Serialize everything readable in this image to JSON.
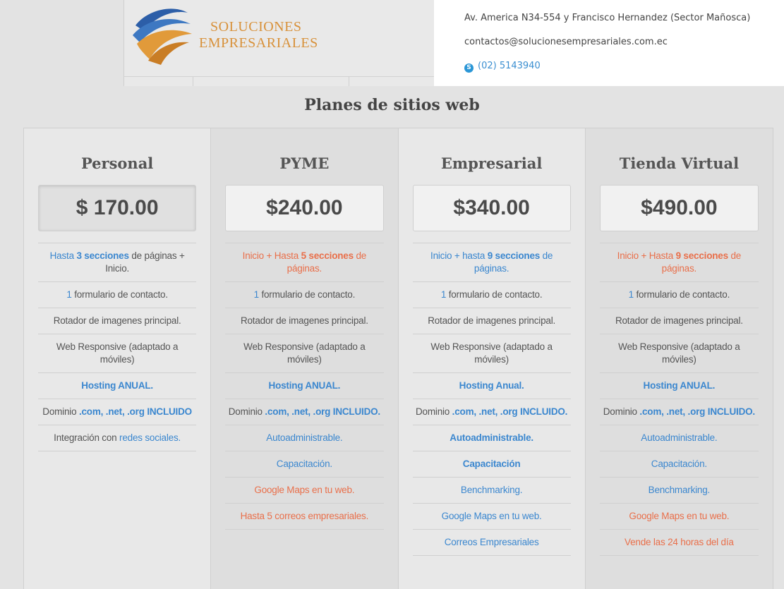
{
  "header": {
    "logo_line1": "SOLUCIONES",
    "logo_line2": "EMPRESARIALES",
    "address": "Av. America N34-554 y Francisco Hernandez (Sector Mañosca)",
    "email": "contactos@solucionesempresariales.com.ec",
    "phone": "(02) 5143940",
    "phone_icon": "skype-icon"
  },
  "section_title": "Planes de sitios web",
  "colors": {
    "blue": "#3b87cf",
    "orange": "#e96f4a"
  },
  "plans": [
    {
      "name": "Personal",
      "price": "$ 170.00",
      "features": [
        [
          {
            "t": "Hasta ",
            "c": "blue"
          },
          {
            "t": "3 secciones",
            "c": "blue",
            "b": true
          },
          {
            "t": " de páginas + Inicio.",
            "c": ""
          }
        ],
        [
          {
            "t": "1",
            "c": "blue"
          },
          {
            "t": " formulario de contacto.",
            "c": ""
          }
        ],
        [
          {
            "t": "Rotador de imagenes principal.",
            "c": ""
          }
        ],
        [
          {
            "t": "Web Responsive (adaptado a móviles)",
            "c": ""
          }
        ],
        [
          {
            "t": "Hosting ANUAL.",
            "c": "blue",
            "b": true
          }
        ],
        [
          {
            "t": "Dominio ",
            "c": ""
          },
          {
            "t": ".com, .net, .org INCLUIDO",
            "c": "blue",
            "b": true
          }
        ],
        [
          {
            "t": "Integración con ",
            "c": ""
          },
          {
            "t": "redes sociales.",
            "c": "blue"
          }
        ]
      ]
    },
    {
      "name": "PYME",
      "price": "$240.00",
      "features": [
        [
          {
            "t": "Inicio + Hasta ",
            "c": "orange"
          },
          {
            "t": "5 secciones",
            "c": "orange",
            "b": true
          },
          {
            "t": " de páginas.",
            "c": "orange"
          }
        ],
        [
          {
            "t": "1",
            "c": "blue"
          },
          {
            "t": " formulario de contacto.",
            "c": ""
          }
        ],
        [
          {
            "t": "Rotador de imagenes principal.",
            "c": ""
          }
        ],
        [
          {
            "t": "Web Responsive (adaptado a móviles)",
            "c": ""
          }
        ],
        [
          {
            "t": "Hosting ANUAL.",
            "c": "blue",
            "b": true
          }
        ],
        [
          {
            "t": "Dominio ",
            "c": ""
          },
          {
            "t": ".com, .net, .org INCLUIDO.",
            "c": "blue",
            "b": true
          }
        ],
        [
          {
            "t": "Autoadministrable.",
            "c": "blue"
          }
        ],
        [
          {
            "t": "Capacitación.",
            "c": "blue"
          }
        ],
        [
          {
            "t": "Google Maps en tu web.",
            "c": "orange"
          }
        ],
        [
          {
            "t": "Hasta 5 correos empresariales.",
            "c": "orange"
          }
        ]
      ]
    },
    {
      "name": "Empresarial",
      "price": "$340.00",
      "features": [
        [
          {
            "t": "Inicio + hasta ",
            "c": "blue"
          },
          {
            "t": "9 secciones",
            "c": "blue",
            "b": true
          },
          {
            "t": " de páginas.",
            "c": "blue"
          }
        ],
        [
          {
            "t": "1",
            "c": "blue"
          },
          {
            "t": " formulario de contacto.",
            "c": ""
          }
        ],
        [
          {
            "t": "Rotador de imagenes principal.",
            "c": ""
          }
        ],
        [
          {
            "t": "Web Responsive (adaptado a móviles)",
            "c": ""
          }
        ],
        [
          {
            "t": "Hosting Anual.",
            "c": "blue",
            "b": true
          }
        ],
        [
          {
            "t": "Dominio ",
            "c": ""
          },
          {
            "t": ".com, .net, .org INCLUIDO.",
            "c": "blue",
            "b": true
          }
        ],
        [
          {
            "t": "Autoadministrable.",
            "c": "blue",
            "b": true
          }
        ],
        [
          {
            "t": "Capacitación",
            "c": "blue",
            "b": true
          }
        ],
        [
          {
            "t": "Benchmarking.",
            "c": "blue"
          }
        ],
        [
          {
            "t": "Google Maps en tu web.",
            "c": "blue"
          }
        ],
        [
          {
            "t": "Correos Empresariales",
            "c": "blue"
          }
        ]
      ]
    },
    {
      "name": "Tienda Virtual",
      "price": "$490.00",
      "features": [
        [
          {
            "t": "Inicio + Hasta ",
            "c": "orange"
          },
          {
            "t": "9 secciones",
            "c": "orange",
            "b": true
          },
          {
            "t": " de páginas.",
            "c": "orange"
          }
        ],
        [
          {
            "t": "1",
            "c": "blue"
          },
          {
            "t": " formulario de contacto.",
            "c": ""
          }
        ],
        [
          {
            "t": "Rotador de imagenes principal.",
            "c": ""
          }
        ],
        [
          {
            "t": "Web Responsive (adaptado a móviles)",
            "c": ""
          }
        ],
        [
          {
            "t": "Hosting ANUAL.",
            "c": "blue",
            "b": true
          }
        ],
        [
          {
            "t": "Dominio ",
            "c": ""
          },
          {
            "t": ".com, .net, .org INCLUIDO.",
            "c": "blue",
            "b": true
          }
        ],
        [
          {
            "t": "Autoadministrable.",
            "c": "blue"
          }
        ],
        [
          {
            "t": "Capacitación.",
            "c": "blue"
          }
        ],
        [
          {
            "t": "Benchmarking.",
            "c": "blue"
          }
        ],
        [
          {
            "t": "Google Maps en tu web.",
            "c": "orange"
          }
        ],
        [
          {
            "t": "Vende las 24 horas del día",
            "c": "orange"
          }
        ]
      ]
    }
  ]
}
